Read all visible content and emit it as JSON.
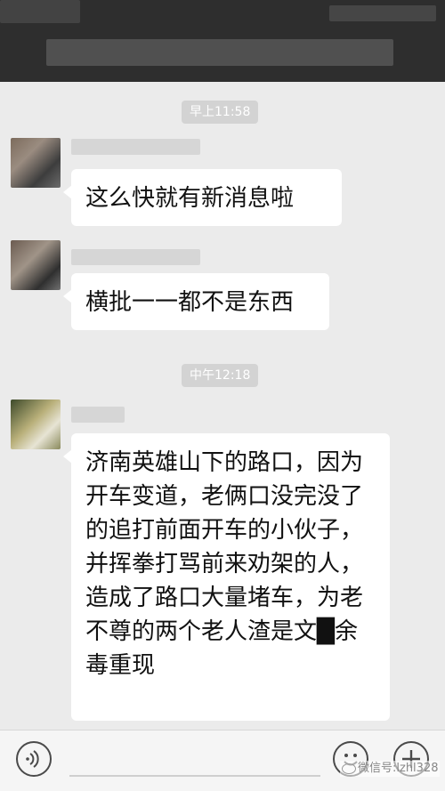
{
  "colors": {
    "chat_background": "#ebebeb",
    "header_background": "#2e2e2e",
    "bubble_background": "#ffffff",
    "timestamp_chip": "#d3d3d3"
  },
  "messages": [
    {
      "type": "timestamp",
      "text": "早上11:58"
    },
    {
      "type": "incoming",
      "sender": "",
      "text": "这么快就有新消息啦"
    },
    {
      "type": "incoming",
      "sender": "",
      "text": "横批一一都不是东西"
    },
    {
      "type": "timestamp",
      "text": "中午12:18"
    },
    {
      "type": "incoming",
      "sender": "",
      "text": "济南英雄山下的路口，因为开车变道，老俩口没完没了的追打前面开车的小伙子，并挥拳打骂前来劝架的人，造成了路口大量堵车，为老不尊的两个老人渣是文█余毒重现"
    }
  ],
  "input_bar": {
    "voice_icon": "voice-icon",
    "emoji_icon": "emoji-icon",
    "plus_icon": "plus-icon"
  },
  "watermark": {
    "text": "微信号:lzhl328"
  }
}
